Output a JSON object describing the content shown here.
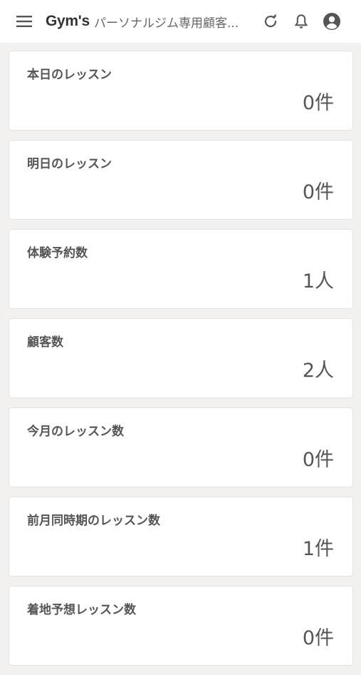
{
  "header": {
    "brand": "Gym's",
    "subtitle": "パーソナルジム専用顧客...",
    "icons": [
      "menu-icon",
      "refresh-icon",
      "bell-icon",
      "account-icon"
    ]
  },
  "cards": [
    {
      "label": "本日のレッスン",
      "value": "0件"
    },
    {
      "label": "明日のレッスン",
      "value": "0件"
    },
    {
      "label": "体験予約数",
      "value": "1人"
    },
    {
      "label": "顧客数",
      "value": "2人"
    },
    {
      "label": "今月のレッスン数",
      "value": "0件"
    },
    {
      "label": "前月同時期のレッスン数",
      "value": "1件"
    },
    {
      "label": "着地予想レッスン数",
      "value": "0件"
    }
  ]
}
